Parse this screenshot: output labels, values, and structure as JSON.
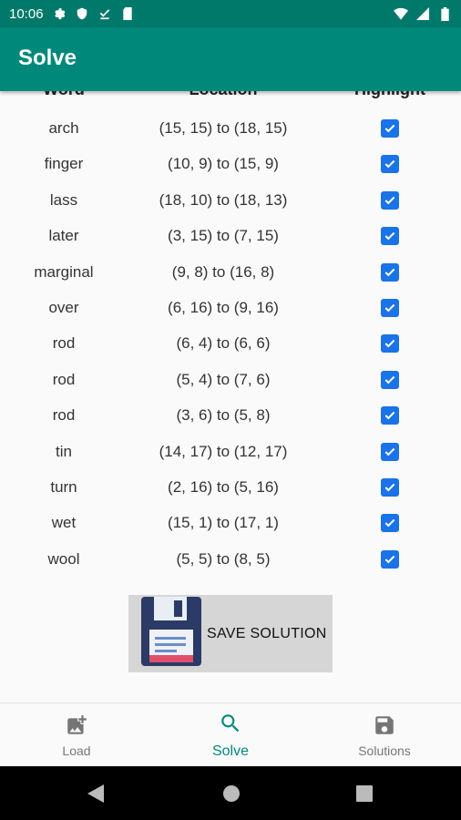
{
  "status_bar": {
    "time": "10:06"
  },
  "app_bar": {
    "title": "Solve"
  },
  "table": {
    "headers": {
      "word": "Word",
      "location": "Location",
      "highlight": "Highlight"
    },
    "rows": [
      {
        "word": "arch",
        "location": "(15, 15) to (18, 15)",
        "checked": true
      },
      {
        "word": "finger",
        "location": "(10, 9) to (15, 9)",
        "checked": true
      },
      {
        "word": "lass",
        "location": "(18, 10) to (18, 13)",
        "checked": true
      },
      {
        "word": "later",
        "location": "(3, 15) to (7, 15)",
        "checked": true
      },
      {
        "word": "marginal",
        "location": "(9, 8) to (16, 8)",
        "checked": true
      },
      {
        "word": "over",
        "location": "(6, 16) to (9, 16)",
        "checked": true
      },
      {
        "word": "rod",
        "location": "(6, 4) to (6, 6)",
        "checked": true
      },
      {
        "word": "rod",
        "location": "(5, 4) to (7, 6)",
        "checked": true
      },
      {
        "word": "rod",
        "location": "(3, 6) to (5, 8)",
        "checked": true
      },
      {
        "word": "tin",
        "location": "(14, 17) to (12, 17)",
        "checked": true
      },
      {
        "word": "turn",
        "location": "(2, 16) to (5, 16)",
        "checked": true
      },
      {
        "word": "wet",
        "location": "(15, 1) to (17, 1)",
        "checked": true
      },
      {
        "word": "wool",
        "location": "(5, 5) to (8, 5)",
        "checked": true
      }
    ]
  },
  "save_button": {
    "label": "SAVE SOLUTION",
    "icon": "floppy-disk-icon"
  },
  "bottom_nav": {
    "items": [
      {
        "label": "Load",
        "icon": "add-photo-icon",
        "active": false
      },
      {
        "label": "Solve",
        "icon": "search-icon",
        "active": true
      },
      {
        "label": "Solutions",
        "icon": "save-icon",
        "active": false
      }
    ]
  },
  "colors": {
    "primary": "#00897b",
    "status_bar": "#00796b",
    "checkbox": "#1a73e8"
  }
}
